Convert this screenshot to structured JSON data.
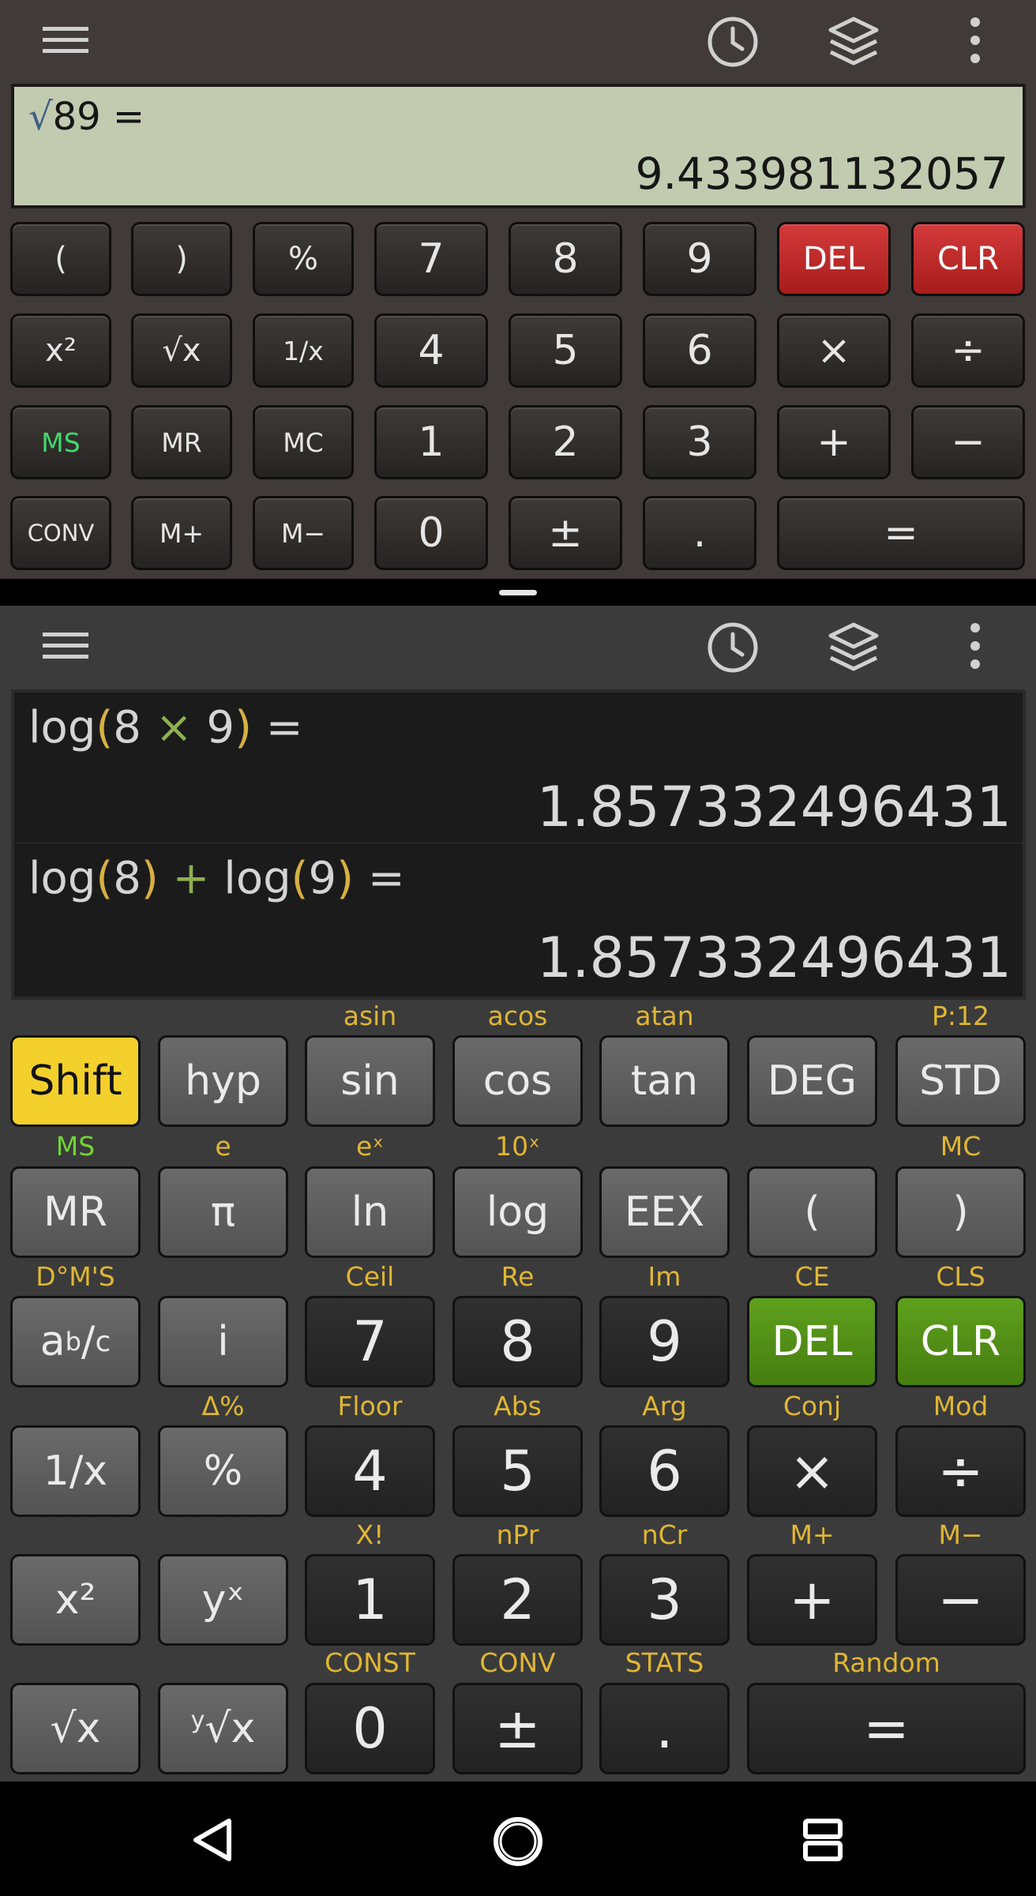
{
  "calc1": {
    "display": {
      "sqrt_symbol": "√",
      "expression": "89 =",
      "result": "9.433981132057"
    },
    "keys": {
      "lparen": "(",
      "rparen": ")",
      "percent": "%",
      "k7": "7",
      "k8": "8",
      "k9": "9",
      "del": "DEL",
      "clr": "CLR",
      "square": "x²",
      "sqrt": "√x",
      "reciprocal": "1/x",
      "k4": "4",
      "k5": "5",
      "k6": "6",
      "mul": "×",
      "div": "÷",
      "ms": "MS",
      "mr": "MR",
      "mc": "MC",
      "k1": "1",
      "k2": "2",
      "k3": "3",
      "plus": "+",
      "minus": "−",
      "conv": "CONV",
      "mplus": "M+",
      "mminus": "M−",
      "k0": "0",
      "plusminus": "±",
      "dot": ".",
      "equals": "="
    }
  },
  "calc2": {
    "history": [
      {
        "fn": "log",
        "lparen": "(",
        "a": "8",
        "op": "×",
        "b": "9",
        "rparen": ")",
        "eq": "=",
        "result": "1.857332496431"
      },
      {
        "fn1": "log",
        "lp1": "(",
        "a": "8",
        "rp1": ")",
        "op": "+",
        "fn2": "log",
        "lp2": "(",
        "b": "9",
        "rp2": ")",
        "eq": "=",
        "result": "1.857332496431"
      }
    ],
    "keys": {
      "shift": "Shift",
      "hyp": "hyp",
      "sin": "sin",
      "cos": "cos",
      "tan": "tan",
      "deg": "DEG",
      "std": "STD",
      "mr": "MR",
      "pi": "π",
      "ln": "ln",
      "log": "log",
      "eex": "EEX",
      "lparen": "(",
      "rparen": ")",
      "frac_a": "a",
      "frac_b": "b",
      "frac_slash": "/",
      "frac_c": "c",
      "i": "i",
      "k7": "7",
      "k8": "8",
      "k9": "9",
      "del": "DEL",
      "clr": "CLR",
      "reciprocal": "1/x",
      "percent": "%",
      "k4": "4",
      "k5": "5",
      "k6": "6",
      "mul": "×",
      "div": "÷",
      "square": "x²",
      "power": "yˣ",
      "k1": "1",
      "k2": "2",
      "k3": "3",
      "plus": "+",
      "minus": "−",
      "sqrt": "√x",
      "root_y": "y",
      "root_x": "√x",
      "k0": "0",
      "plusminus": "±",
      "dot": ".",
      "equals": "="
    },
    "shift_labels": {
      "asin": "asin",
      "acos": "acos",
      "atan": "atan",
      "precision": "P:12",
      "ms": "MS",
      "e": "e",
      "ex": "eˣ",
      "tenx": "10ˣ",
      "mc": "MC",
      "dms": "D°M'S",
      "ceil": "Ceil",
      "re": "Re",
      "im": "Im",
      "ce": "CE",
      "cls": "CLS",
      "delta_pct": "Δ%",
      "floor": "Floor",
      "abs": "Abs",
      "arg": "Arg",
      "conj": "Conj",
      "mod": "Mod",
      "fact": "X!",
      "npr": "nPr",
      "ncr": "nCr",
      "mplus": "M+",
      "mminus": "M−",
      "const": "CONST",
      "conv": "CONV",
      "stats": "STATS",
      "random": "Random"
    }
  },
  "icons": {
    "menu": "menu-icon",
    "history": "clock-icon",
    "layers": "layers-icon",
    "more": "more-vert-icon",
    "nav_back": "back-triangle-icon",
    "nav_home": "home-circle-icon",
    "nav_recents": "recents-icon"
  },
  "colors": {
    "lcd_bg": "#c2cbaf",
    "red_key": "#c62828",
    "green_key": "#5a9a1a",
    "shift_key": "#f3d02b",
    "shift_label": "#e0b634",
    "memory_label": "#72d435"
  }
}
